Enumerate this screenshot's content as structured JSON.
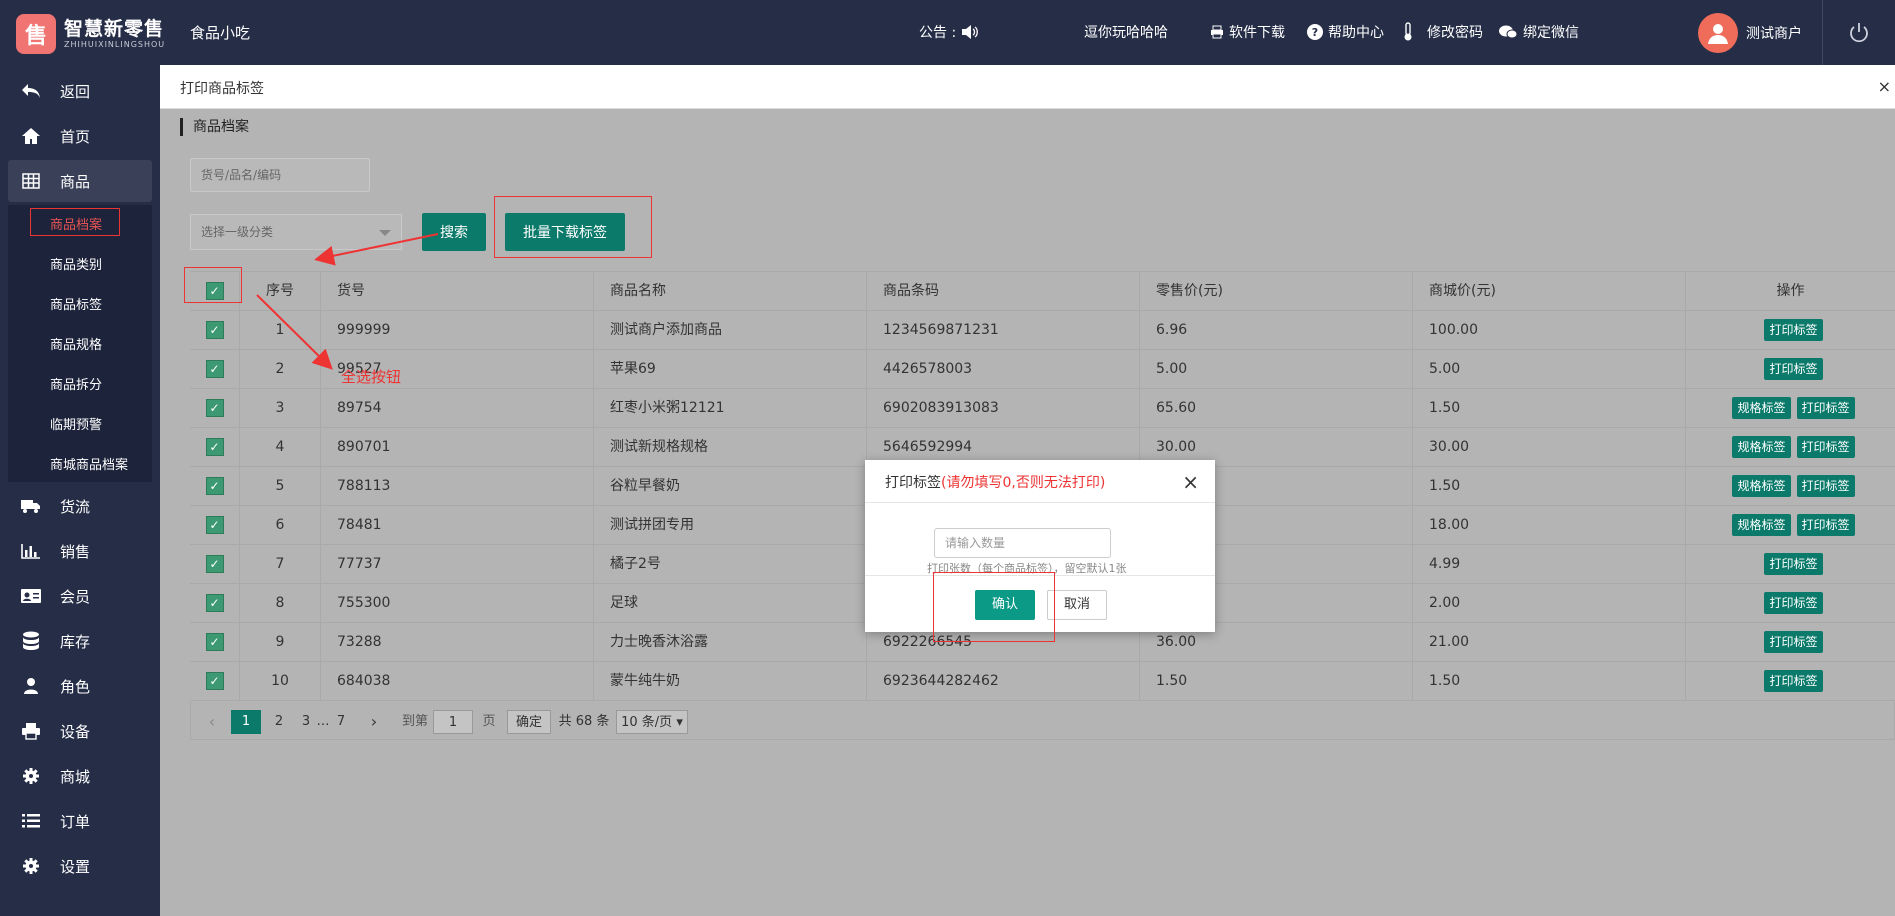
{
  "header": {
    "logo_char": "售",
    "logo_name": "智慧新零售",
    "logo_sub": "ZHIHUIXINLINGSHOU",
    "store": "食品小吃",
    "notice": "公告 :",
    "marquee": "逗你玩哈哈哈",
    "links": [
      "软件下载",
      "帮助中心",
      "修改密码",
      "绑定微信"
    ],
    "user": "测试商户"
  },
  "sidebar": {
    "items": [
      "返回",
      "首页",
      "商品",
      "货流",
      "销售",
      "会员",
      "库存",
      "角色",
      "设备",
      "商城",
      "订单",
      "设置"
    ],
    "sub_items": [
      "商品档案",
      "商品类别",
      "商品标签",
      "商品规格",
      "商品拆分",
      "临期预警",
      "商城商品档案"
    ]
  },
  "page": {
    "title": "打印商品标签",
    "close": "×",
    "section": "商品档案",
    "search_placeholder": "货号/品名/编码",
    "category_placeholder": "选择一级分类",
    "search_btn": "搜索",
    "batch_btn": "批量下载标签"
  },
  "table": {
    "headers": [
      "序号",
      "货号",
      "商品名称",
      "商品条码",
      "零售价(元)",
      "商城价(元)",
      "操作"
    ],
    "rows": [
      [
        "1",
        "999999",
        "测试商户添加商品",
        "1234569871231",
        "6.96",
        "100.00"
      ],
      [
        "2",
        "99527",
        "苹果69",
        "4426578003",
        "5.00",
        "5.00"
      ],
      [
        "3",
        "89754",
        "红枣小米粥12121",
        "6902083913083",
        "65.60",
        "1.50"
      ],
      [
        "4",
        "890701",
        "测试新规格规格",
        "5646592994",
        "30.00",
        "30.00"
      ],
      [
        "5",
        "788113",
        "谷粒早餐奶",
        "",
        "",
        "1.50"
      ],
      [
        "6",
        "78481",
        "测试拼团专用",
        "",
        "",
        "18.00"
      ],
      [
        "7",
        "77737",
        "橘子2号",
        "",
        "",
        "4.99"
      ],
      [
        "8",
        "755300",
        "足球",
        "",
        "",
        "2.00"
      ],
      [
        "9",
        "73288",
        "力士晚香沐浴露",
        "6922266545",
        "36.00",
        "21.00"
      ],
      [
        "10",
        "684038",
        "蒙牛纯牛奶",
        "6923644282462",
        "1.50",
        "1.50"
      ]
    ],
    "ops_spec": "规格标签",
    "ops_print": "打印标签"
  },
  "pager": {
    "prev": "‹",
    "pages": [
      "1",
      "2",
      "3",
      "…",
      "7"
    ],
    "next": "›",
    "goto": "到第",
    "goto_value": "1",
    "page_unit": "页",
    "confirm": "确定",
    "total": "共 68 条",
    "per_page": "10 条/页"
  },
  "annotation": {
    "select_all": "全选按钮"
  },
  "dialog": {
    "title": "打印标签",
    "warning": "(请勿填写0,否则无法打印)",
    "input_placeholder": "请输入数量",
    "hint": "打印张数（每个商品标签），留空默认1张",
    "ok": "确认",
    "cancel": "取消"
  }
}
